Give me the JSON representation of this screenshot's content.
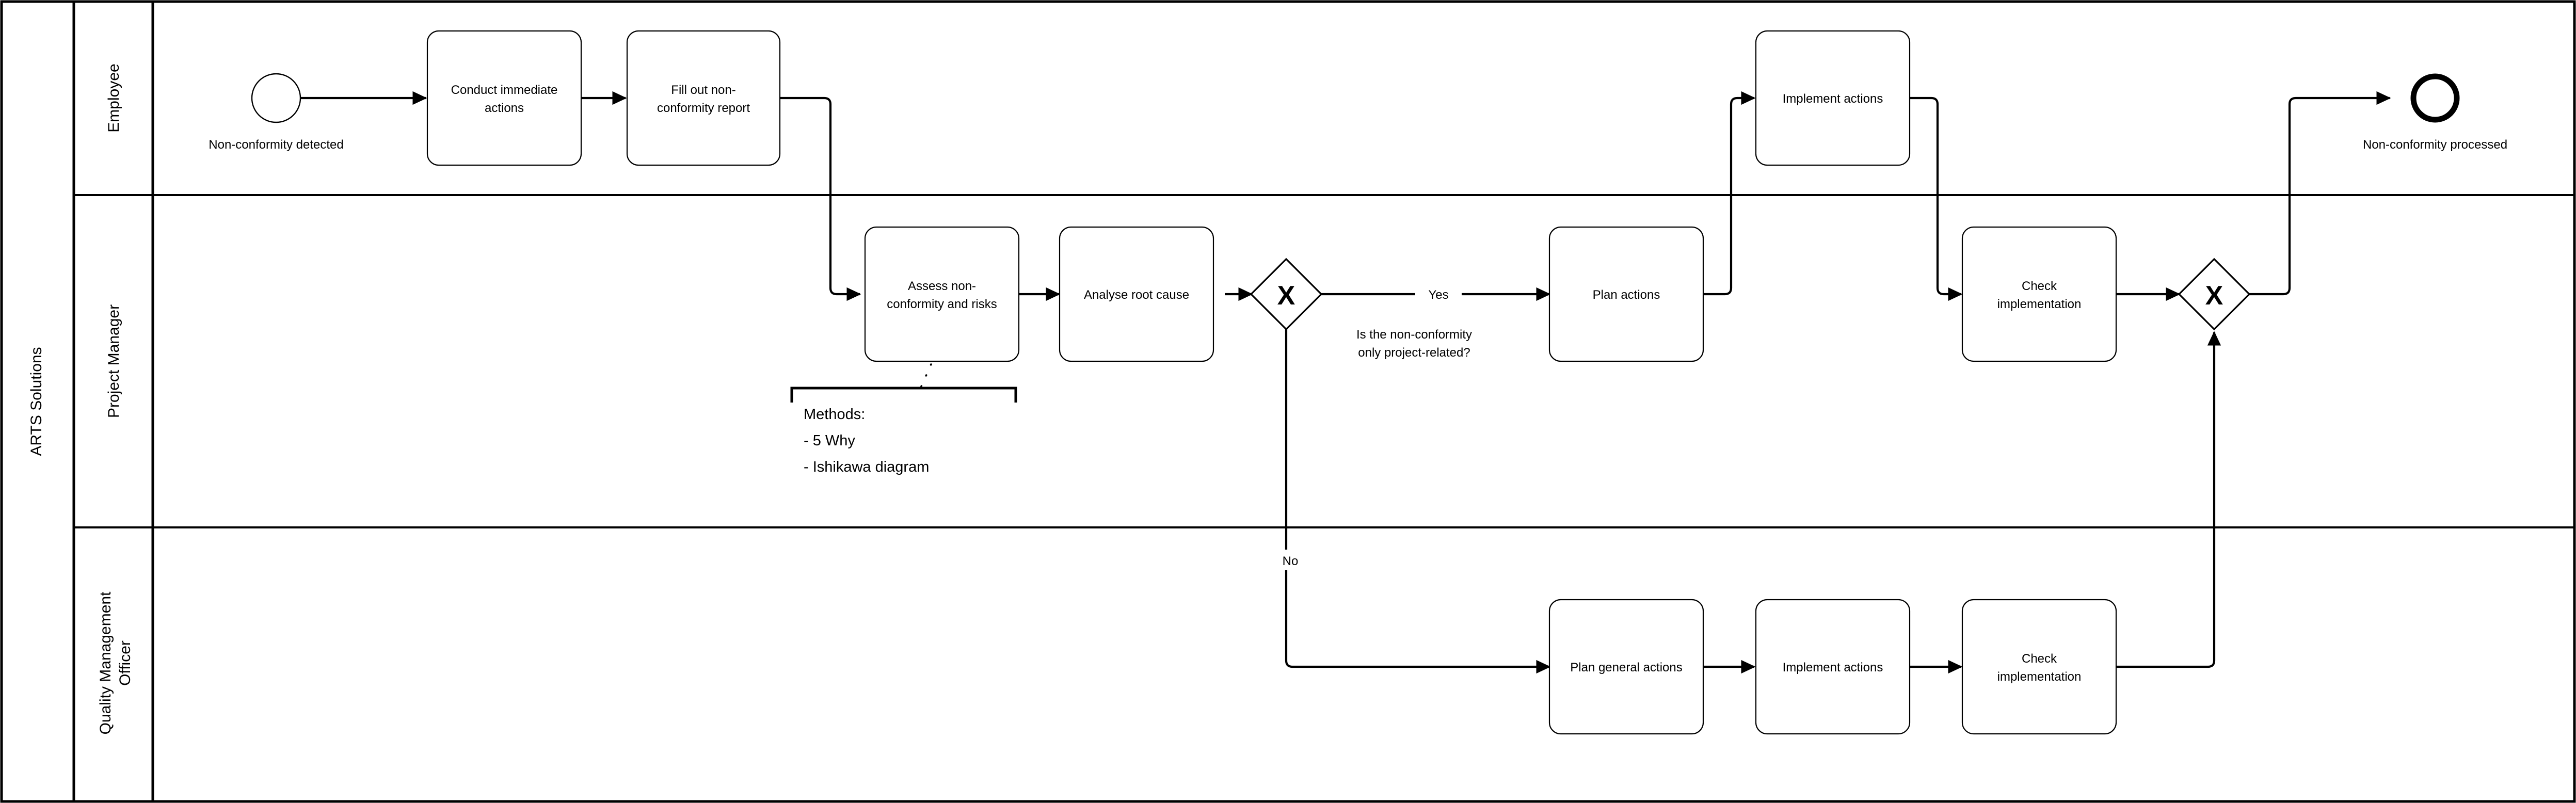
{
  "diagram": {
    "type": "bpmn-collaboration",
    "pool": {
      "name": "ARTS Solutions"
    },
    "lanes": [
      {
        "id": "employee",
        "name": "Employee"
      },
      {
        "id": "project_manager",
        "name": "Project Manager"
      },
      {
        "id": "qmo",
        "name": "Quality Management\nOfficer",
        "line1": "Quality Management",
        "line2": "Officer"
      }
    ],
    "events": [
      {
        "id": "start",
        "kind": "start-event",
        "lane": "employee",
        "label": "Non-conformity detected"
      },
      {
        "id": "end",
        "kind": "end-event",
        "lane": "employee",
        "label": "Non-conformity processed"
      }
    ],
    "tasks": [
      {
        "id": "t1",
        "lane": "employee",
        "label": "Conduct immediate actions",
        "line1": "Conduct immediate",
        "line2": "actions"
      },
      {
        "id": "t2",
        "lane": "employee",
        "label": "Fill out non-conformity report",
        "line1": "Fill out non-",
        "line2": "conformity report"
      },
      {
        "id": "t3",
        "lane": "project_manager",
        "label": "Assess non-conformity and risks",
        "line1": "Assess non-",
        "line2": "conformity and risks"
      },
      {
        "id": "t4",
        "lane": "project_manager",
        "label": "Analyse root cause",
        "line1": "Analyse root cause",
        "line2": ""
      },
      {
        "id": "t5",
        "lane": "project_manager",
        "label": "Plan actions",
        "line1": "Plan actions",
        "line2": ""
      },
      {
        "id": "t6",
        "lane": "employee",
        "label": "Implement actions",
        "line1": "Implement actions",
        "line2": ""
      },
      {
        "id": "t7",
        "lane": "project_manager",
        "label": "Check implementation",
        "line1": "Check",
        "line2": "implementation"
      },
      {
        "id": "t8",
        "lane": "qmo",
        "label": "Plan general actions",
        "line1": "Plan general actions",
        "line2": ""
      },
      {
        "id": "t9",
        "lane": "qmo",
        "label": "Implement actions",
        "line1": "Implement actions",
        "line2": ""
      },
      {
        "id": "t10",
        "lane": "qmo",
        "label": "Check implementation",
        "line1": "Check",
        "line2": "implementation"
      }
    ],
    "gateways": [
      {
        "id": "gw1",
        "kind": "exclusive-gateway",
        "marker": "X",
        "lane": "project_manager",
        "label": "Is the non-conformity only project-related?",
        "line1": "Is the non-conformity",
        "line2": "only project-related?"
      },
      {
        "id": "gw2",
        "kind": "exclusive-gateway",
        "marker": "X",
        "lane": "project_manager",
        "label": "",
        "line1": "",
        "line2": ""
      }
    ],
    "flow_labels": [
      {
        "id": "yes",
        "text": "Yes"
      },
      {
        "id": "no",
        "text": "No"
      }
    ],
    "annotation": {
      "id": "methods-note",
      "attached_to": "t3",
      "line1": "Methods:",
      "line2": "- 5 Why",
      "line3": "- Ishikawa diagram"
    },
    "colors": {
      "stroke": "#000000",
      "fill": "#ffffff",
      "background": "#ffffff"
    }
  }
}
